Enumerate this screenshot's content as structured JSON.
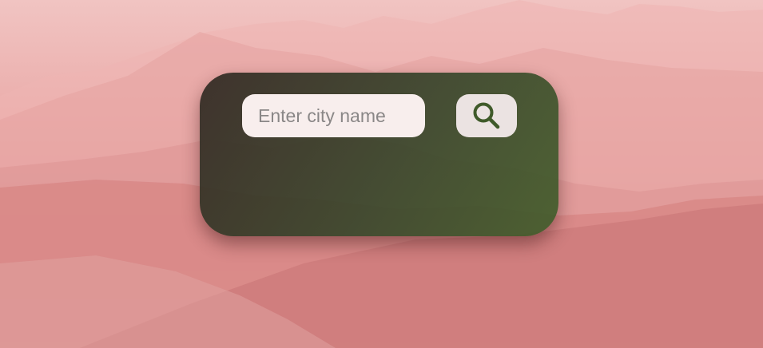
{
  "search": {
    "placeholder": "Enter city name",
    "value": "",
    "button_icon": "search-icon"
  },
  "colors": {
    "card_dark": "#302822",
    "card_green": "#3e5c28",
    "input_bg": "#f8eeed",
    "button_bg": "#ebe3e2",
    "icon_color": "#3f5a2a"
  }
}
